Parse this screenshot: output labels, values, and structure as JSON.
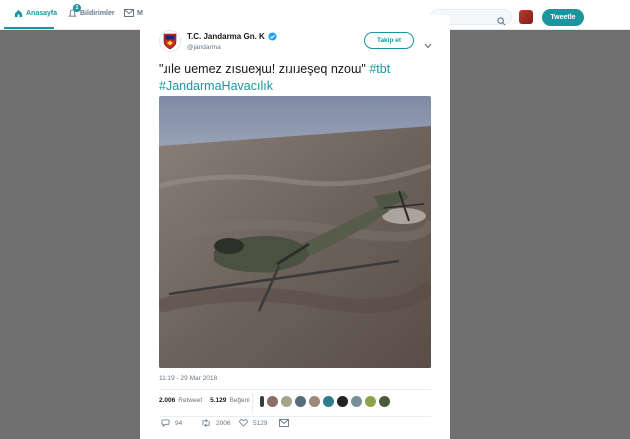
{
  "nav": {
    "home_label": "Anasayfa",
    "notifications_label": "Bildirimler",
    "notifications_badge": "2",
    "messages_label": "M"
  },
  "header": {
    "tweet_button": "Tweetle"
  },
  "tweet": {
    "author_name": "T.C. Jandarma Gn. K",
    "handle": "@jandarma",
    "follow_label": "Takip et",
    "text": "\"ɹıle uemez zısueʞɯ! zıɹıɹeşeq nzoɯ\"",
    "text_plain": "\"ɹıle uemez zısueʞɯ! zıɹıɹeşeq nzoɯ\"",
    "hashtags": [
      "#tbt",
      "#JandarmaHavacılık"
    ],
    "timestamp": "11:19 - 29 Mar 2018",
    "retweet_count": "2.006",
    "retweet_label": "Retweet",
    "like_count": "5.129",
    "like_label": "Beğeni",
    "reply_count": "94",
    "retweet_action_count": "2006",
    "like_action_count": "5129"
  },
  "colors": {
    "accent": "#1b95a0",
    "backdrop": "#6f6f6f",
    "verified": "#1da1f2"
  }
}
